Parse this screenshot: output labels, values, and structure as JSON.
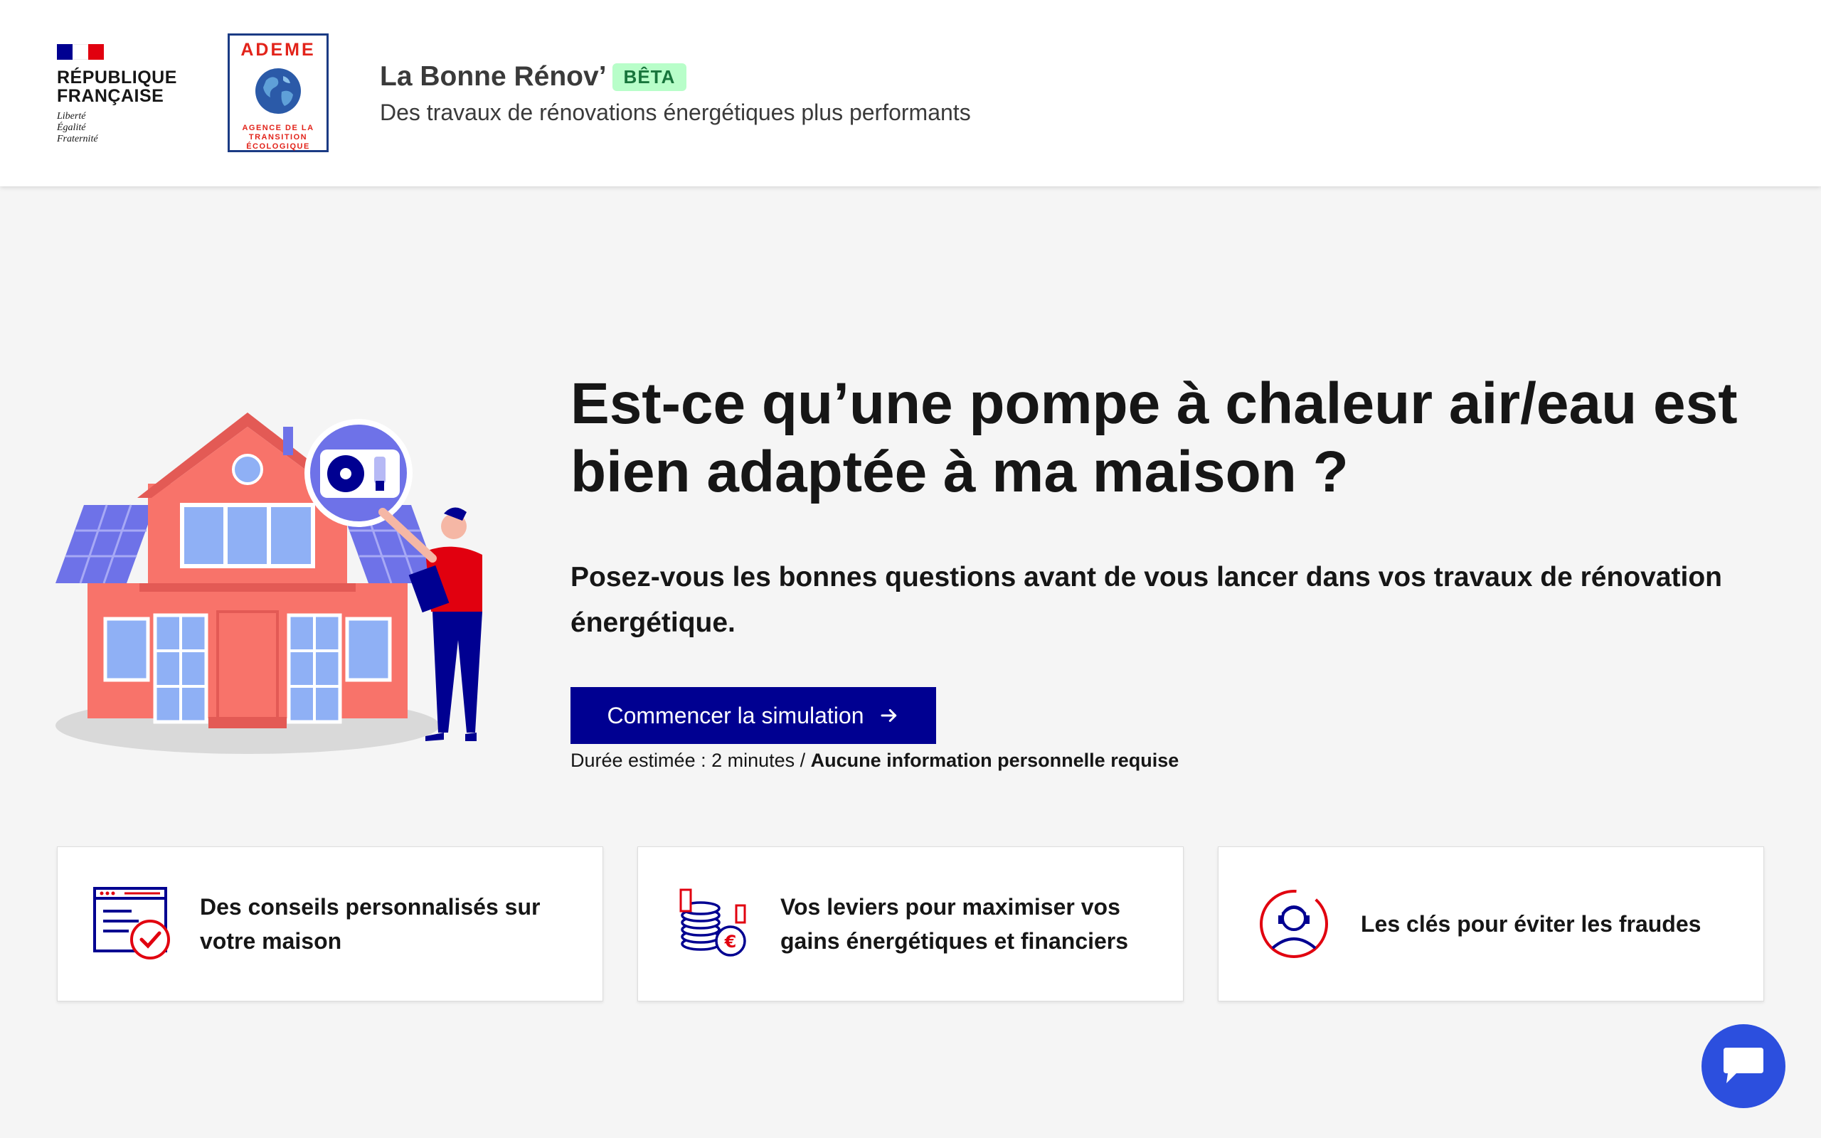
{
  "header": {
    "rf": {
      "name": "RÉPUBLIQUE\nFRANÇAISE",
      "motto": "Liberté\nÉgalité\nFraternité",
      "flag_colors": [
        "#000091",
        "#ffffff",
        "#e1000f"
      ]
    },
    "ademe": {
      "title": "ADEME",
      "subtitle": "AGENCE DE LA\nTRANSITION\nÉCOLOGIQUE",
      "color": "#e2231a"
    },
    "service": {
      "title": "La Bonne Rénov’",
      "badge": "BÊTA",
      "tagline": "Des travaux de rénovations énergétiques plus performants"
    }
  },
  "hero": {
    "illustration_icon": "house-heat-pump-illustration",
    "title": "Est-ce qu’une pompe à chaleur air/eau est bien adaptée à ma maison ?",
    "subtitle": "Posez-vous les bonnes questions avant de vous lancer dans vos travaux de rénovation énergétique.",
    "cta_label": "Commencer la simulation",
    "duration_prefix": "Durée estimée : 2 minutes / ",
    "duration_bold": "Aucune information personnelle requise"
  },
  "cards": [
    {
      "icon": "personalized-advice-icon",
      "text": "Des conseils personnalisés sur votre maison"
    },
    {
      "icon": "coins-euro-icon",
      "text": "Vos leviers pour maximiser vos gains énergétiques et financiers"
    },
    {
      "icon": "fraud-protection-icon",
      "text": "Les clés pour éviter les fraudes"
    }
  ],
  "chat": {
    "icon": "chat-bubble-icon"
  },
  "colors": {
    "primary": "#000091",
    "accent_red": "#e1000f",
    "beta_bg": "#b8fec9",
    "beta_text": "#18753c",
    "chat": "#2c4fde"
  }
}
